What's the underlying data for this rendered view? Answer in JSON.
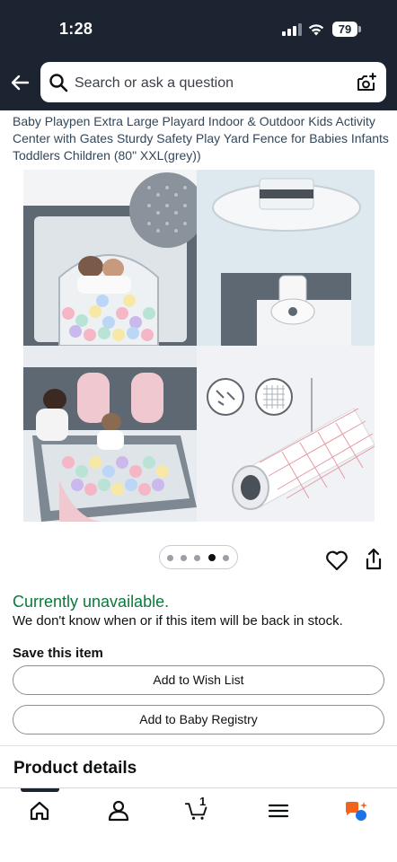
{
  "status_bar": {
    "time": "1:28",
    "battery": "79"
  },
  "header": {
    "search_placeholder": "Search or ask a question",
    "back_icon": "arrow-left-icon",
    "search_icon": "search-icon",
    "camera_icon": "camera-plus-icon"
  },
  "product": {
    "title": "Baby Playpen Extra Large Playard Indoor & Outdoor Kids Activity Center with Gates Sturdy Safety Play Yard Fence for Babies Infants Toddlers Children (80\" XXL(grey))",
    "gallery": {
      "page_count": 5,
      "active_index": 3
    }
  },
  "availability": {
    "status": "Currently unavailable.",
    "note": "We don't know when or if this item will be back in stock."
  },
  "save": {
    "title": "Save this item",
    "wishlist_label": "Add to Wish List",
    "registry_label": "Add to Baby Registry"
  },
  "details": {
    "heading": "Product details"
  },
  "bottom_nav": {
    "items": [
      "home-icon",
      "account-icon",
      "cart-icon",
      "menu-icon",
      "rufus-icon"
    ],
    "cart_count": "1"
  },
  "colors": {
    "header_bg": "#1b2430",
    "unavailable_green": "#0a7a3b",
    "rufus_orange": "#f2641e",
    "rufus_blue": "#1a73e8"
  }
}
